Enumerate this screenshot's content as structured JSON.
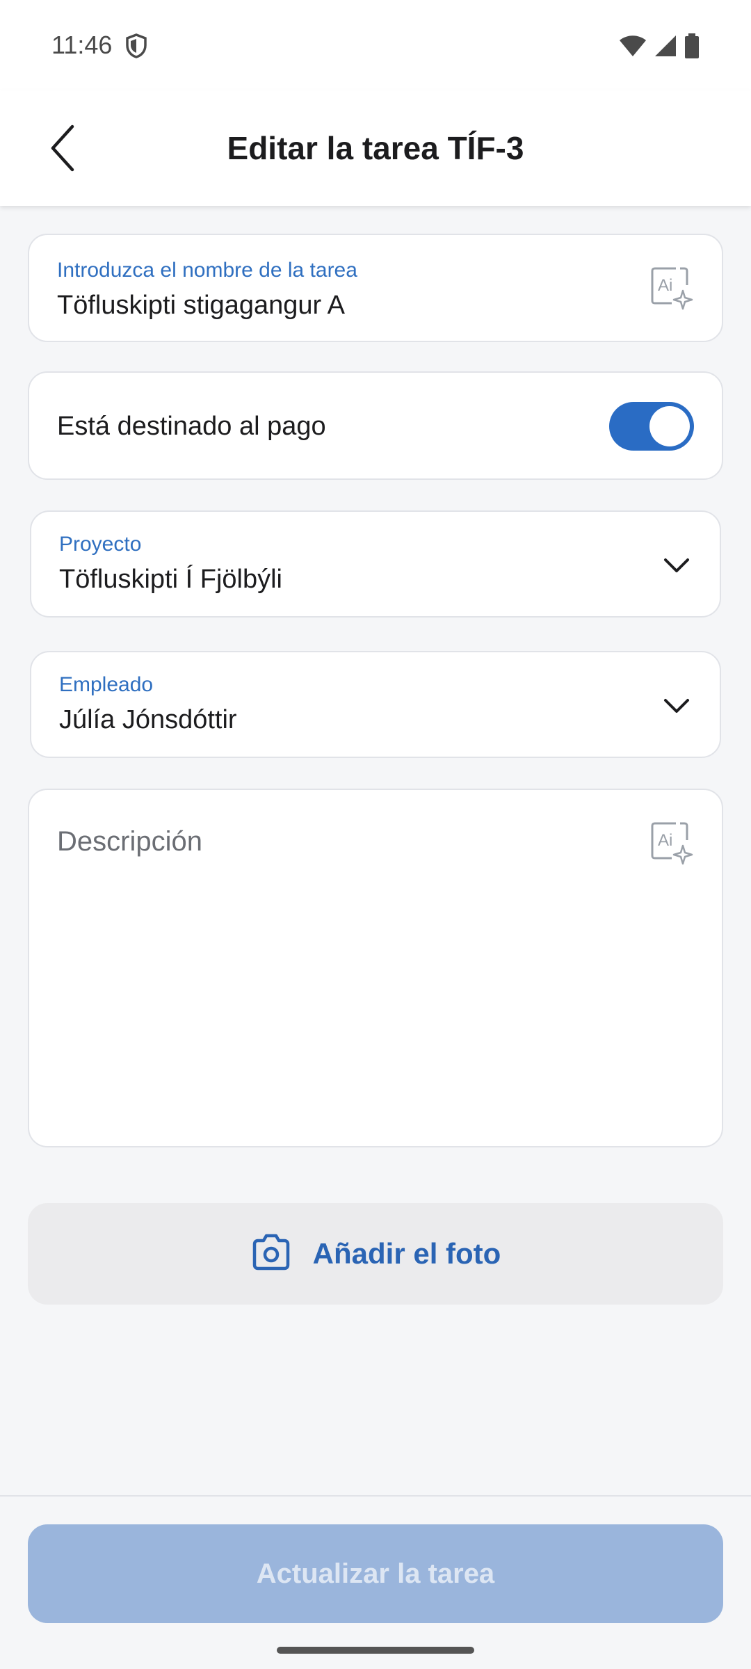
{
  "status_bar": {
    "time": "11:46"
  },
  "app_bar": {
    "title": "Editar la tarea TÍF-3"
  },
  "task_name": {
    "label": "Introduzca el nombre de la tarea",
    "value": "Töfluskipti stigagangur A"
  },
  "payment": {
    "label": "Está destinado al pago",
    "enabled": true
  },
  "project": {
    "label": "Proyecto",
    "value": "Töfluskipti Í Fjölbýli"
  },
  "employee": {
    "label": "Empleado",
    "value": "Júlía Jónsdóttir"
  },
  "description": {
    "placeholder": "Descripción",
    "value": ""
  },
  "photo_button": {
    "label": "Añadir el foto"
  },
  "update_button": {
    "label": "Actualizar la tarea"
  },
  "colors": {
    "accent": "#2a6cc4",
    "label_blue": "#2f6fc0",
    "disabled_button": "#9ab5dc"
  }
}
